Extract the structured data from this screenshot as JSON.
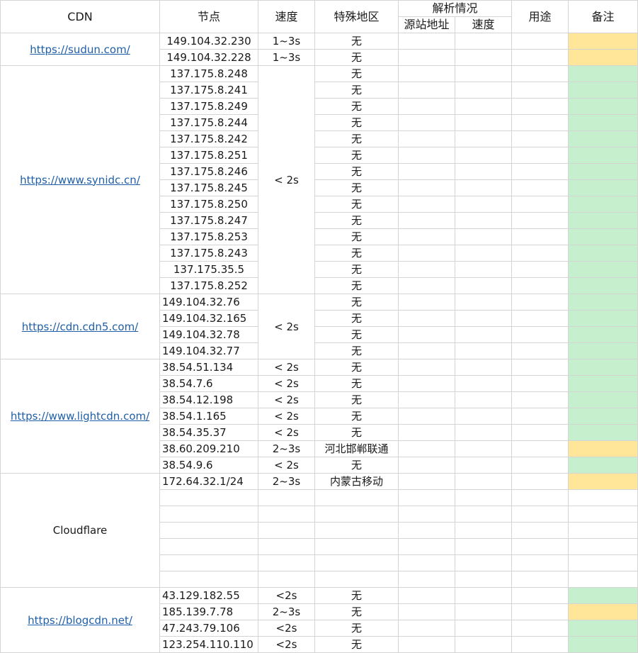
{
  "headers": {
    "cdn": "CDN",
    "node": "节点",
    "speed": "速度",
    "region": "特殊地区",
    "resolve": "解析情况",
    "origin": "源站地址",
    "resolve_speed": "速度",
    "usage": "用途",
    "note": "备注"
  },
  "colors": {
    "green": "#c6efce",
    "yellow": "#ffe699",
    "link": "#1f5fa8"
  },
  "groups": [
    {
      "cdn": "https://sudun.com/",
      "link": true,
      "speed": null,
      "rows": [
        {
          "node": "149.104.32.230",
          "align": "center",
          "speed": "1~3s",
          "region": "无",
          "note": "yellow"
        },
        {
          "node": "149.104.32.228",
          "align": "center",
          "speed": "1~3s",
          "region": "无",
          "note": "yellow"
        }
      ]
    },
    {
      "cdn": "https://www.synidc.cn/",
      "link": true,
      "speed": "< 2s",
      "rows": [
        {
          "node": "137.175.8.248",
          "align": "center",
          "region": "无",
          "note": "green"
        },
        {
          "node": "137.175.8.241",
          "align": "center",
          "region": "无",
          "note": "green"
        },
        {
          "node": "137.175.8.249",
          "align": "center",
          "region": "无",
          "note": "green"
        },
        {
          "node": "137.175.8.244",
          "align": "center",
          "region": "无",
          "note": "green"
        },
        {
          "node": "137.175.8.242",
          "align": "center",
          "region": "无",
          "note": "green"
        },
        {
          "node": "137.175.8.251",
          "align": "center",
          "region": "无",
          "note": "green"
        },
        {
          "node": "137.175.8.246",
          "align": "center",
          "region": "无",
          "note": "green"
        },
        {
          "node": "137.175.8.245",
          "align": "center",
          "region": "无",
          "note": "green"
        },
        {
          "node": "137.175.8.250",
          "align": "center",
          "region": "无",
          "note": "green"
        },
        {
          "node": "137.175.8.247",
          "align": "center",
          "region": "无",
          "note": "green"
        },
        {
          "node": "137.175.8.253",
          "align": "center",
          "region": "无",
          "note": "green"
        },
        {
          "node": "137.175.8.243",
          "align": "center",
          "region": "无",
          "note": "green"
        },
        {
          "node": "137.175.35.5",
          "align": "center",
          "region": "无",
          "note": "green"
        },
        {
          "node": "137.175.8.252",
          "align": "center",
          "region": "无",
          "note": "green"
        }
      ]
    },
    {
      "cdn": "https://cdn.cdn5.com/",
      "link": true,
      "speed": "< 2s",
      "rows": [
        {
          "node": "149.104.32.76",
          "align": "left",
          "region": "无",
          "note": "green"
        },
        {
          "node": "149.104.32.165",
          "align": "left",
          "region": "无",
          "note": "green"
        },
        {
          "node": "149.104.32.78",
          "align": "left",
          "region": "无",
          "note": "green"
        },
        {
          "node": "149.104.32.77",
          "align": "left",
          "region": "无",
          "note": "green"
        }
      ]
    },
    {
      "cdn": "https://www.lightcdn.com/",
      "link": true,
      "speed": null,
      "rows": [
        {
          "node": "38.54.51.134",
          "align": "left",
          "speed": "< 2s",
          "region": "无",
          "note": "green"
        },
        {
          "node": "38.54.7.6",
          "align": "left",
          "speed": "< 2s",
          "region": "无",
          "note": "green"
        },
        {
          "node": "38.54.12.198",
          "align": "left",
          "speed": "< 2s",
          "region": "无",
          "note": "green"
        },
        {
          "node": "38.54.1.165",
          "align": "left",
          "speed": "< 2s",
          "region": "无",
          "note": "green"
        },
        {
          "node": "38.54.35.37",
          "align": "left",
          "speed": "< 2s",
          "region": "无",
          "note": "green"
        },
        {
          "node": "38.60.209.210",
          "align": "left",
          "speed": "2~3s",
          "region": "河北邯郸联通",
          "note": "yellow"
        },
        {
          "node": "38.54.9.6",
          "align": "left",
          "speed": "< 2s",
          "region": "无",
          "note": "green"
        }
      ]
    },
    {
      "cdn": "Cloudflare",
      "link": false,
      "speed": null,
      "rows": [
        {
          "node": "172.64.32.1/24",
          "align": "left",
          "speed": "2~3s",
          "region": "内蒙古移动",
          "note": "yellow"
        },
        {
          "node": "",
          "align": "left",
          "speed": "",
          "region": "",
          "note": "none"
        },
        {
          "node": "",
          "align": "left",
          "speed": "",
          "region": "",
          "note": "none"
        },
        {
          "node": "",
          "align": "left",
          "speed": "",
          "region": "",
          "note": "none"
        },
        {
          "node": "",
          "align": "left",
          "speed": "",
          "region": "",
          "note": "none"
        },
        {
          "node": "",
          "align": "left",
          "speed": "",
          "region": "",
          "note": "none"
        },
        {
          "node": "",
          "align": "left",
          "speed": "",
          "region": "",
          "note": "none"
        }
      ]
    },
    {
      "cdn": "https://blogcdn.net/",
      "link": true,
      "speed": null,
      "rows": [
        {
          "node": "43.129.182.55",
          "align": "left",
          "speed": "<2s",
          "region": "无",
          "note": "green"
        },
        {
          "node": "185.139.7.78",
          "align": "left",
          "speed": "2~3s",
          "region": "无",
          "note": "yellow"
        },
        {
          "node": "47.243.79.106",
          "align": "left",
          "speed": "<2s",
          "region": "无",
          "note": "green"
        },
        {
          "node": "123.254.110.110",
          "align": "left",
          "speed": "<2s",
          "region": "无",
          "note": "green"
        }
      ]
    }
  ]
}
